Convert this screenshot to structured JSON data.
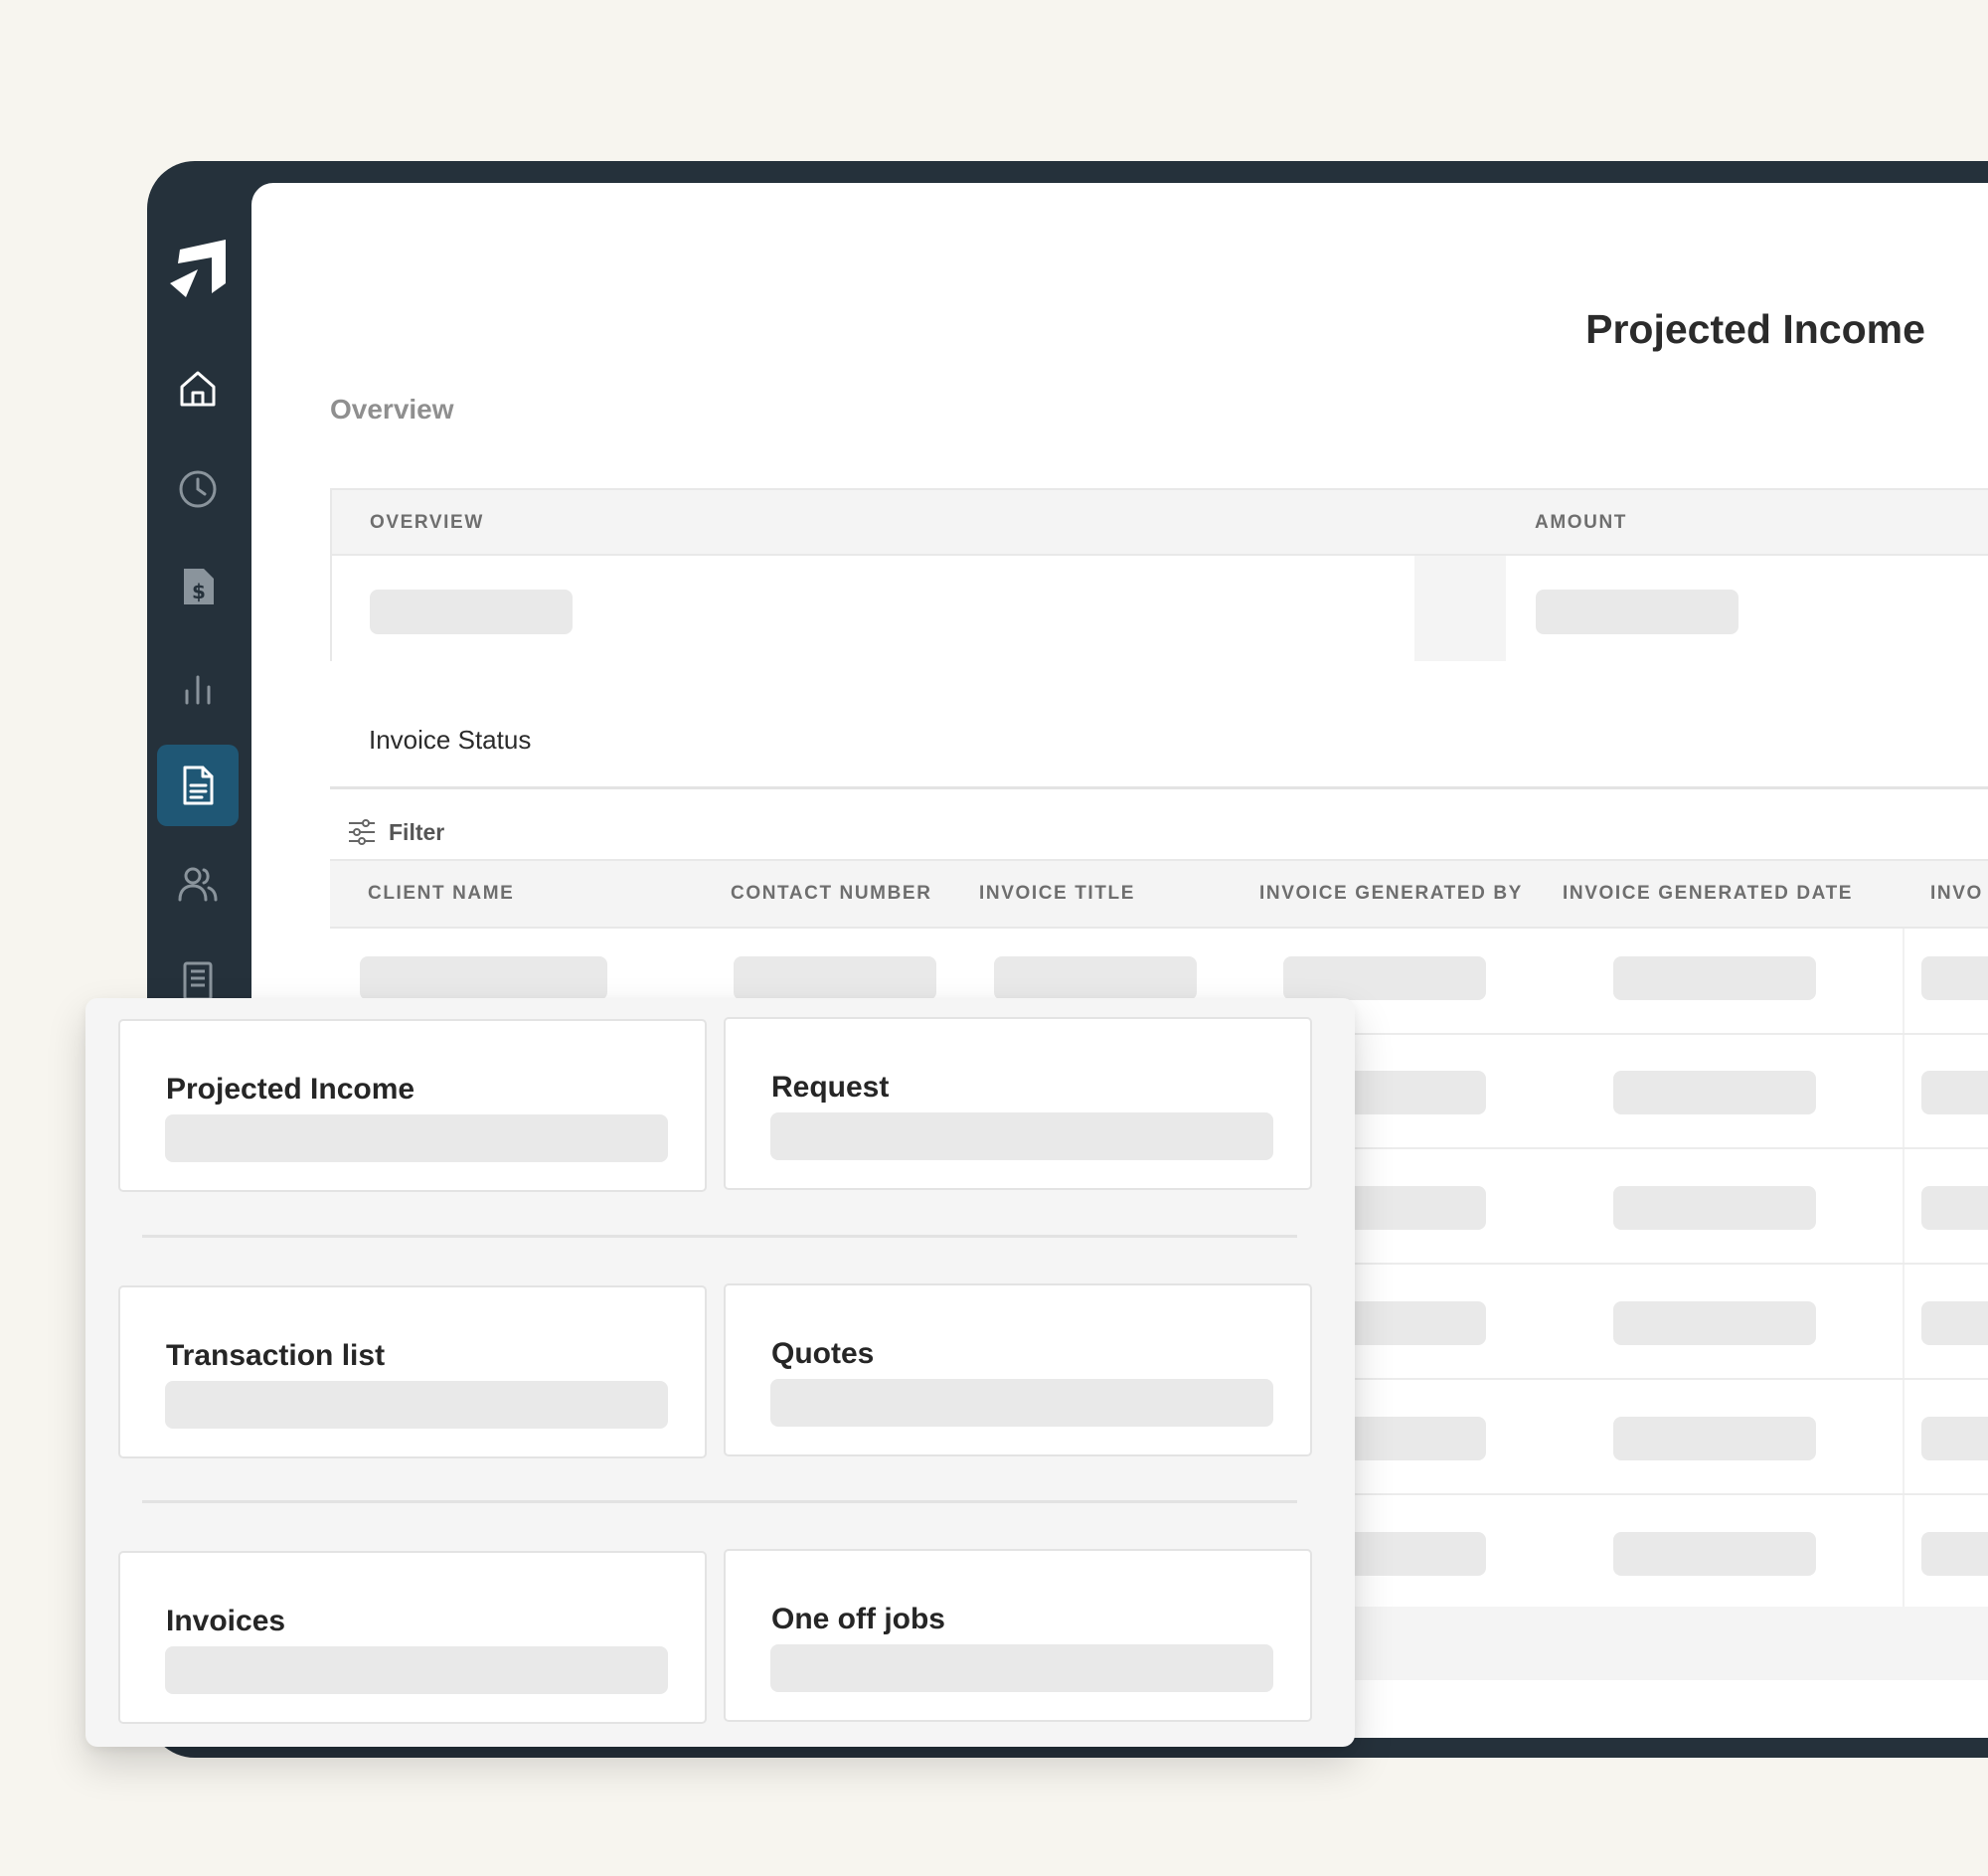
{
  "app": {
    "accent": "#1f5775",
    "frame_color": "#25313b",
    "background": "#f7f5ef"
  },
  "sidebar": {
    "items": [
      {
        "icon": "home-icon",
        "active": false
      },
      {
        "icon": "clock-icon",
        "active": false
      },
      {
        "icon": "invoice-dollar-icon",
        "active": false
      },
      {
        "icon": "bar-chart-icon",
        "active": false
      },
      {
        "icon": "document-icon",
        "active": true
      },
      {
        "icon": "users-icon",
        "active": false
      },
      {
        "icon": "receipt-icon",
        "active": false
      }
    ]
  },
  "page": {
    "title": "Projected Income",
    "section_label": "Overview"
  },
  "overview_table": {
    "columns": [
      "OVERVIEW",
      "AMOUNT"
    ]
  },
  "invoice_status": {
    "label": "Invoice Status",
    "filter_label": "Filter",
    "columns": [
      "CLIENT NAME",
      "CONTACT NUMBER",
      "INVOICE TITLE",
      "INVOICE GENERATED BY",
      "INVOICE GENERATED DATE",
      "INVO"
    ]
  },
  "overlay": {
    "cards": [
      {
        "title": "Projected Income"
      },
      {
        "title": "Request"
      },
      {
        "title": "Transaction list"
      },
      {
        "title": "Quotes"
      },
      {
        "title": "Invoices"
      },
      {
        "title": "One off jobs"
      }
    ]
  }
}
